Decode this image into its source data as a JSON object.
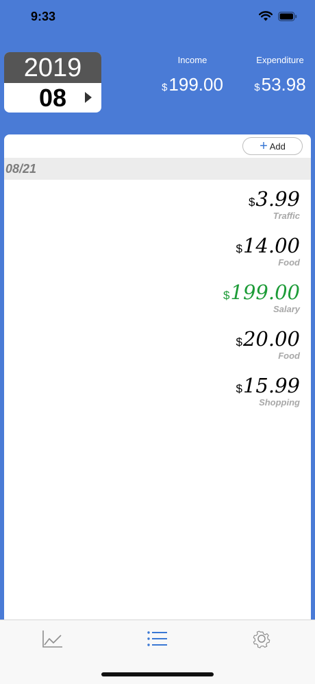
{
  "status_bar": {
    "time": "9:33",
    "icons": [
      "wifi-icon",
      "battery-icon"
    ]
  },
  "date_picker": {
    "year": "2019",
    "month": "08"
  },
  "summary": {
    "income_label": "Income",
    "income_currency": "$",
    "income_amount": "199.00",
    "expense_label": "Expenditure",
    "expense_currency": "$",
    "expense_amount": "53.98"
  },
  "list": {
    "add_label": "Add",
    "date_header": "08/21",
    "transactions": [
      {
        "currency": "$",
        "amount": "3.99",
        "category": "Traffic",
        "type": "expense"
      },
      {
        "currency": "$",
        "amount": "14.00",
        "category": "Food",
        "type": "expense"
      },
      {
        "currency": "$",
        "amount": "199.00",
        "category": "Salary",
        "type": "income"
      },
      {
        "currency": "$",
        "amount": "20.00",
        "category": "Food",
        "type": "expense"
      },
      {
        "currency": "$",
        "amount": "15.99",
        "category": "Shopping",
        "type": "expense"
      }
    ]
  },
  "tabs": [
    {
      "icon": "chart-icon",
      "active": false
    },
    {
      "icon": "list-icon",
      "active": true
    },
    {
      "icon": "gear-icon",
      "active": false
    }
  ],
  "colors": {
    "background": "#4a7bd6",
    "income_green": "#1c9b37",
    "accent_blue": "#3a78d4",
    "tab_inactive": "#8e8e8e"
  }
}
